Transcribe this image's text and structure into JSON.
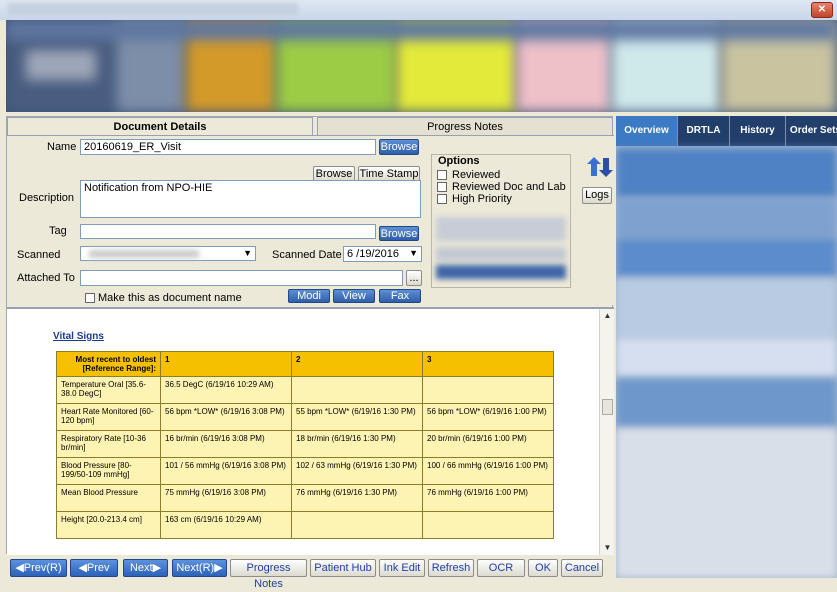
{
  "window": {
    "close_label": "✕"
  },
  "left_tabs": {
    "document_details": "Document Details",
    "progress_notes": "Progress Notes"
  },
  "form": {
    "name_label": "Name",
    "name_value": "20160619_ER_Visit",
    "browse_label": "Browse",
    "browse2_label": "Browse",
    "time_stamp_label": "Time Stamp",
    "description_label": "Description",
    "description_value": "Notification from NPO-HIE",
    "tag_label": "Tag",
    "tag_browse_label": "Browse",
    "scanned_label": "Scanned",
    "scanned_date_label": "Scanned Date",
    "scanned_date_value": "6 /19/2016",
    "attached_to_label": "Attached To",
    "attached_ellipsis": "...",
    "make_doc_name_label": "Make this as document name",
    "modi_label": "Modi",
    "view_label": "View",
    "fax_label": "Fax"
  },
  "options": {
    "title": "Options",
    "reviewed": "Reviewed",
    "reviewed_doc_lab": "Reviewed Doc and Lab",
    "high_priority": "High Priority"
  },
  "logs_label": "Logs",
  "vital_signs": {
    "title": "Vital Signs",
    "header": [
      "Most recent to oldest [Reference Range]:",
      "1",
      "2",
      "3"
    ],
    "rows": [
      {
        "name": "Temperature Oral [35.6-38.0 DegC]",
        "c1": "36.5 DegC (6/19/16 10:29 AM)",
        "c2": "",
        "c3": ""
      },
      {
        "name": "Heart Rate Monitored [60-120 bpm]",
        "c1": "56 bpm *LOW* (6/19/16 3:08 PM)",
        "c2": "55 bpm *LOW* (6/19/16 1:30 PM)",
        "c3": "56 bpm *LOW* (6/19/16 1:00 PM)"
      },
      {
        "name": "Respiratory Rate [10-36 br/min]",
        "c1": "16 br/min (6/19/16 3:08 PM)",
        "c2": "18 br/min (6/19/16 1:30 PM)",
        "c3": "20 br/min (6/19/16 1:00 PM)"
      },
      {
        "name": "Blood Pressure [80-199/50-109 mmHg]",
        "c1": "101 / 56 mmHg (6/19/16 3:08 PM)",
        "c2": "102 / 63 mmHg (6/19/16 1:30 PM)",
        "c3": "100 / 66 mmHg (6/19/16 1:00 PM)"
      },
      {
        "name": "Mean Blood Pressure",
        "c1": "75 mmHg (6/19/16 3:08 PM)",
        "c2": "76 mmHg (6/19/16 1:30 PM)",
        "c3": "76 mmHg (6/19/16 1:00 PM)"
      },
      {
        "name": "Height [20.0-213.4 cm]",
        "c1": "163 cm (6/19/16 10:29 AM)",
        "c2": "",
        "c3": ""
      }
    ]
  },
  "bottom_buttons": {
    "prev_r": "Prev(R)",
    "prev": "Prev",
    "next": "Next",
    "next_r": "Next(R)",
    "progress_notes": "Progress Notes",
    "patient_hub": "Patient Hub",
    "ink_edit": "Ink Edit",
    "refresh": "Refresh",
    "ocr": "OCR",
    "ok": "OK",
    "cancel": "Cancel"
  },
  "right_tabs": {
    "overview": "Overview",
    "drtla": "DRTLA",
    "history": "History",
    "order_sets": "Order Sets"
  }
}
